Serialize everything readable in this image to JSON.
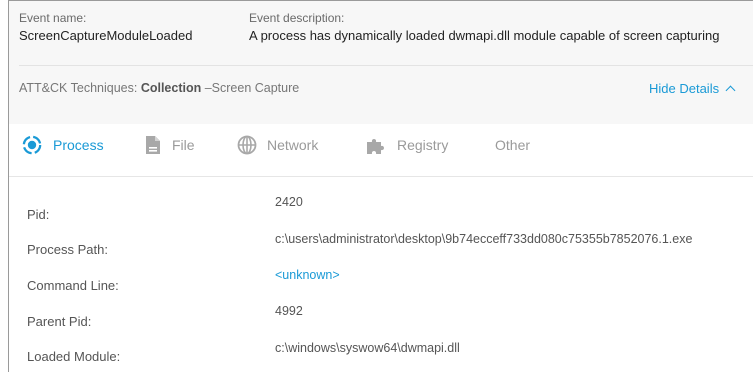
{
  "event": {
    "name_label": "Event name:",
    "name_value": "ScreenCaptureModuleLoaded",
    "description_label": "Event description:",
    "description_value": "A process has dynamically loaded dwmapi.dll module capable of screen capturing"
  },
  "attack": {
    "prefix": "ATT&CK Techniques: ",
    "tactic": "Collection",
    "technique": " –Screen Capture"
  },
  "hide_details_label": "Hide Details",
  "tabs": [
    {
      "label": "Process",
      "icon": "process-icon",
      "active": true
    },
    {
      "label": "File",
      "icon": "file-icon",
      "active": false
    },
    {
      "label": "Network",
      "icon": "globe-icon",
      "active": false
    },
    {
      "label": "Registry",
      "icon": "puzzle-icon",
      "active": false
    },
    {
      "label": "Other",
      "icon": "",
      "active": false
    }
  ],
  "details": [
    {
      "label": "Pid:",
      "value": "2420"
    },
    {
      "label": "Process Path:",
      "value": "c:\\users\\administrator\\desktop\\9b74ecceff733dd080c75355b7852076.1.exe"
    },
    {
      "label": "Command Line:",
      "value": "<unknown>"
    },
    {
      "label": "Parent Pid:",
      "value": "4992"
    },
    {
      "label": "Loaded Module:",
      "value": "c:\\windows\\syswow64\\dwmapi.dll"
    }
  ],
  "colors": {
    "accent": "#1a9ad6",
    "header_bg": "#f7f7f7",
    "muted_text": "#9a9a9a"
  }
}
